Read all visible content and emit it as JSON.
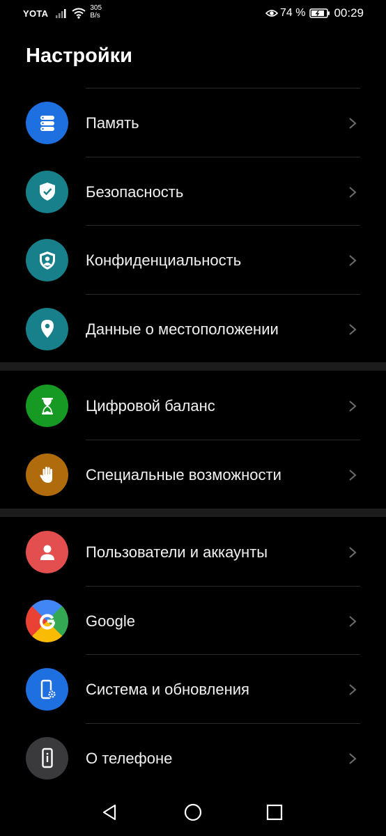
{
  "status_bar": {
    "carrier": "YOTA",
    "net_speed_value": "305",
    "net_speed_unit": "B/s",
    "battery_percent": "74 %",
    "time": "00:29"
  },
  "title": "Настройки",
  "groups": [
    {
      "items": [
        {
          "label": "Память",
          "icon": "storage-icon",
          "color": "#1e6fe0"
        },
        {
          "label": "Безопасность",
          "icon": "shield-check-icon",
          "color": "#17808a"
        },
        {
          "label": "Конфиденциальность",
          "icon": "privacy-icon",
          "color": "#17808a"
        },
        {
          "label": "Данные о местоположении",
          "icon": "location-pin-icon",
          "color": "#17808a"
        }
      ]
    },
    {
      "items": [
        {
          "label": "Цифровой баланс",
          "icon": "hourglass-icon",
          "color": "#169a24"
        },
        {
          "label": "Специальные возможности",
          "icon": "hand-icon",
          "color": "#b06c0c"
        }
      ]
    },
    {
      "items": [
        {
          "label": "Пользователи и аккаунты",
          "icon": "user-icon",
          "color": "#e34e4e"
        },
        {
          "label": "Google",
          "icon": "google-icon",
          "color": "#ffffff"
        },
        {
          "label": "Система и обновления",
          "icon": "system-update-icon",
          "color": "#1e6fe0"
        },
        {
          "label": "О телефоне",
          "icon": "phone-info-icon",
          "color": "#3a3a3c"
        }
      ]
    }
  ],
  "navigation": {
    "back_icon": "back-triangle-icon",
    "home_icon": "home-circle-icon",
    "recents_icon": "recents-square-icon"
  }
}
